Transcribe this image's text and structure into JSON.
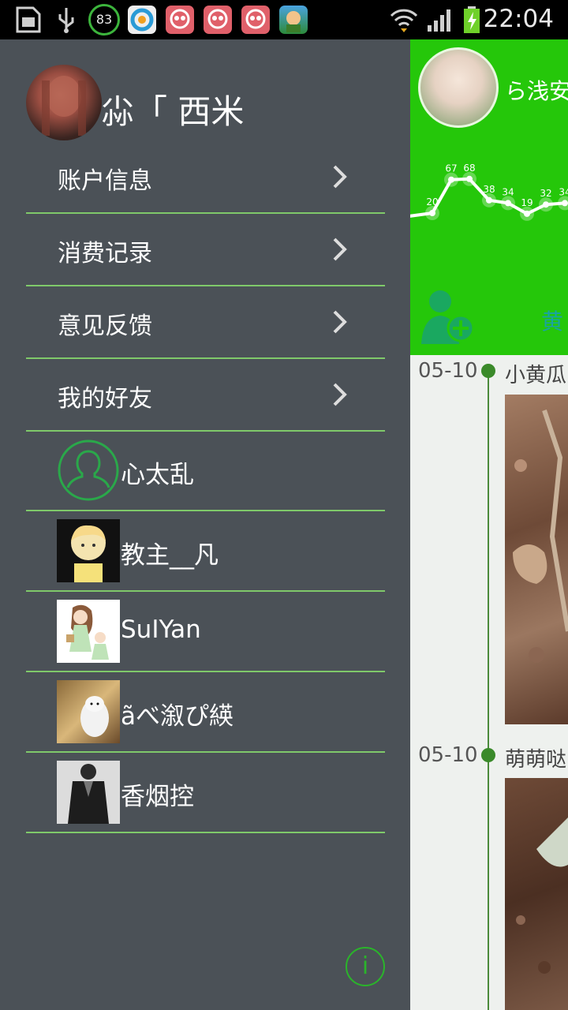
{
  "status_bar": {
    "time": "22:04",
    "battery_badge": "83",
    "icons": [
      "sim-card-icon",
      "usb-icon",
      "battery-badge-icon",
      "qq-browser-icon",
      "app-icon-1",
      "app-icon-2",
      "app-icon-3",
      "game-icon",
      "wifi-icon",
      "signal-icon",
      "battery-charging-icon"
    ]
  },
  "drawer": {
    "username": "尛「 西米",
    "menu": [
      {
        "label": "账户信息"
      },
      {
        "label": "消费记录"
      },
      {
        "label": "意见反馈"
      },
      {
        "label": "我的好友"
      }
    ],
    "friends": [
      {
        "name": "心太乱",
        "avatar": "default-avatar-icon"
      },
      {
        "name": "教主__凡",
        "avatar": "anime-boy"
      },
      {
        "name": "SuIYan",
        "avatar": "anime-girls"
      },
      {
        "name": "ãべ溆ぴ緓",
        "avatar": "baymax-photo"
      },
      {
        "name": "香烟控",
        "avatar": "man-photo"
      }
    ],
    "info_icon": "i"
  },
  "peek": {
    "name": "ら浅安",
    "name2": "黄",
    "chart_data": {
      "type": "line",
      "values": [
        20,
        67,
        68,
        38,
        34,
        19,
        32,
        34
      ],
      "labels": [
        "20",
        "67",
        "68",
        "38",
        "34",
        "19",
        "32",
        "34"
      ]
    },
    "timeline": [
      {
        "date": "05-10",
        "title": "小黄瓜"
      },
      {
        "date": "05-10",
        "title": "萌萌哒"
      }
    ]
  },
  "colors": {
    "drawer_bg": "#4b5157",
    "accent_green": "#25c70a",
    "divider": "#7fc96a"
  }
}
